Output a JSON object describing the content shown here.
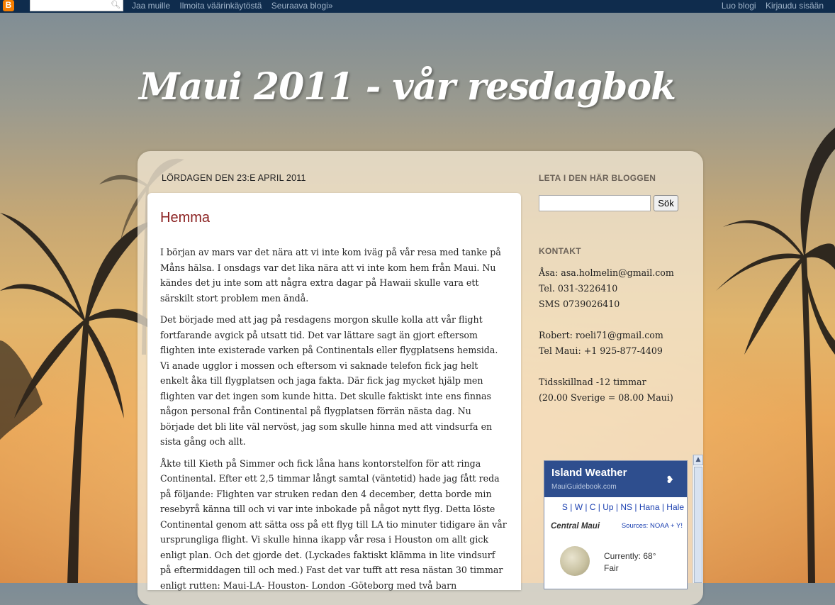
{
  "navbar": {
    "logo": "B",
    "links": [
      "Jaa muille",
      "Ilmoita väärinkäytöstä",
      "Seuraava blogi»"
    ],
    "right_links": [
      "Luo blogi",
      "Kirjaudu sisään"
    ]
  },
  "blog": {
    "title": "Maui 2011 - vår resdagbok"
  },
  "post": {
    "date": "LÖRDAGEN DEN 23:E APRIL 2011",
    "title": "Hemma",
    "paragraphs": [
      "I början av mars var det nära att vi inte kom iväg på vår resa med tanke på Måns hälsa. I onsdags var det lika nära att vi inte kom hem från Maui. Nu kändes det ju inte som att några extra dagar på Hawaii skulle vara ett särskilt stort problem men ändå.",
      "Det började med att jag på resdagens morgon skulle kolla att vår flight fortfarande avgick på utsatt tid. Det var lättare sagt än gjort eftersom flighten inte existerade varken på Continentals eller flygplatsens hemsida. Vi anade ugglor i mossen och eftersom vi saknade telefon fick jag helt enkelt åka till flygplatsen och jaga fakta. Där fick jag mycket hjälp men flighten var det ingen som kunde hitta. Det skulle faktiskt inte ens finnas någon personal från Continental på flygplatsen förrän nästa dag. Nu började det bli lite väl nervöst, jag som skulle hinna med att vindsurfa en sista gång och allt.",
      "Åkte till Kieth på Simmer och fick låna hans kontorstelfon för att ringa Continental. Efter ett 2,5 timmar långt samtal (väntetid) hade jag fått reda på följande: Flighten var struken redan den 4 december, detta borde min resebyrå känna till och vi var inte inbokade på något nytt flyg. Detta löste Continental genom att sätta oss på ett flyg till LA tio minuter tidigare än vår ursprungliga flight. Vi skulle hinna ikapp vår resa i Houston om allt gick enligt plan. Och det gjorde det. (Lyckades faktiskt klämma in lite vindsurf på eftermiddagen till och med.) Fast det var tufft att resa nästan 30 timmar enligt rutten: Maui-LA- Houston- London -Göteborg med två barn"
    ]
  },
  "sidebar": {
    "search_heading": "LETA I DEN HÄR BLOGGEN",
    "search_button": "Sök",
    "search_value": "",
    "contact_heading": "KONTAKT",
    "contact_lines": [
      "Åsa: asa.holmelin@gmail.com",
      "Tel. 031-3226410",
      "SMS 0739026410",
      "",
      "Robert: roeli71@gmail.com",
      "Tel Maui: +1 925-877-4409",
      "",
      "Tidsskillnad -12 timmar",
      "(20.00 Sverige = 08.00 Maui)"
    ]
  },
  "weather": {
    "title": "Island Weather",
    "subtitle": "MauiGuidebook.com",
    "links": "S | W | C | Up | NS | Hana | Hale",
    "region": "Central Maui",
    "sources": "Sources: NOAA + Y!",
    "current": "Currently: 68°",
    "condition": "Fair"
  },
  "colors": {
    "navbar": "#0f2c4d",
    "post_title": "#8a1f1f",
    "weather_header": "#2e4e8e",
    "link_blue": "#1a3fb0"
  }
}
